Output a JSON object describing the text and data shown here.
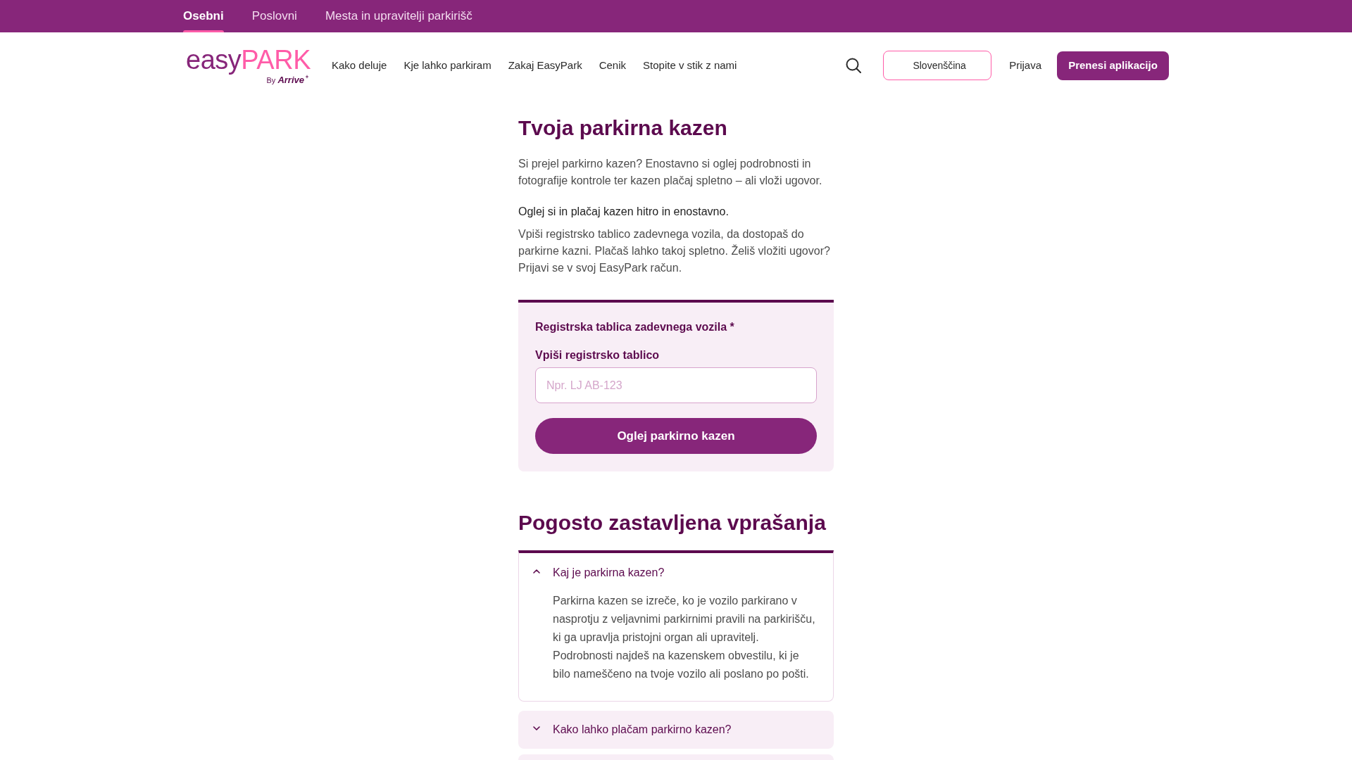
{
  "top_bar": {
    "tabs": [
      {
        "label": "Osebni",
        "selected": true
      },
      {
        "label": "Poslovni",
        "selected": false
      },
      {
        "label": "Mesta in upravitelji parkirišč",
        "selected": false
      }
    ]
  },
  "header": {
    "logo": {
      "wordmark_parts": [
        "easy",
        "PARK"
      ],
      "byline": "By **Arrive**"
    },
    "nav": [
      "Kako deluje",
      "Kje lahko parkiram",
      "Zakaj EasyPark",
      "Cenik",
      "Stopite v stik z nami"
    ],
    "language": "Slovenščina",
    "login": "Prijava",
    "download": "Prenesi aplikacijo"
  },
  "main": {
    "title": "Tvoja parkirna kazen",
    "intro": "Si prejel parkirno kazen? Enostavno si oglej podrobnosti in fotografije kontrole ter kazen plačaj spletno – ali vloži ugovor.",
    "lead": "Oglej si in plačaj kazen hitro in enostavno.",
    "instructions": "Vpiši registrsko tablico zadevnega vozila, da dostopaš do parkirne kazni. Plačaš lahko takoj spletno. Želiš vložiti ugovor? Prijavi se v svoj EasyPark račun.",
    "form": {
      "section_label": "Registrska tablica zadevnega vozila *",
      "field_label": "Vpiši registrsko tablico",
      "placeholder": "Npr. LJ AB-123",
      "submit": "Oglej parkirno kazen"
    }
  },
  "faq": {
    "title": "Pogosto zastavljena vprašanja",
    "items": [
      {
        "question": "Kaj je parkirna kazen?",
        "expanded": true,
        "answer": "Parkirna kazen se izreče, ko je vozilo parkirano v nasprotju z veljavnimi parkirnimi pravili na parkirišču, ki ga upravlja pristojni organ ali upravitelj. Podrobnosti najdeš na kazenskem obvestilu, ki je bilo nameščeno na tvoje vozilo ali poslano po pošti."
      },
      {
        "question": "Kako lahko plačam parkirno kazen?",
        "expanded": false
      },
      {
        "expanded": false
      }
    ]
  }
}
